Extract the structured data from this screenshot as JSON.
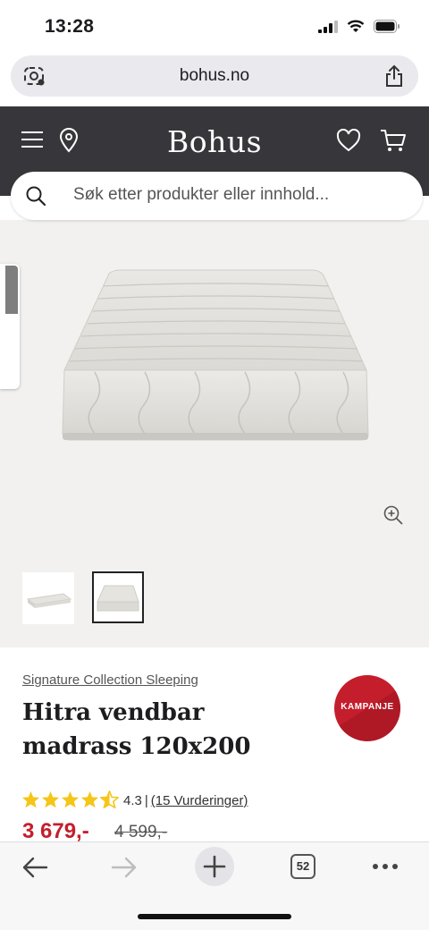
{
  "status_bar": {
    "time": "13:28"
  },
  "browser": {
    "url": "bohus.no",
    "tab_count": "52"
  },
  "header": {
    "brand": "Bohus"
  },
  "search": {
    "placeholder": "Søk etter produkter eller innhold..."
  },
  "product": {
    "brand_line": "Signature Collection Sleeping",
    "title": "Hitra vendbar madrass 120x200",
    "badge": "KAMPANJE",
    "rating_value": "4.3",
    "rating_separator": "|",
    "reviews": "(15 Vurderinger)",
    "rating_stars": 4.3,
    "price": "3 679,-",
    "old_price": "4 599,-"
  },
  "gallery": {
    "thumbnail_count": 2,
    "selected_thumbnail": 2
  },
  "icons": {
    "menu": "hamburger-icon",
    "location": "map-pin-icon",
    "wishlist": "heart-icon",
    "cart": "cart-icon",
    "search": "search-icon",
    "zoom": "zoom-in-icon",
    "back": "arrow-left-icon",
    "forward": "arrow-right-icon",
    "new_tab": "plus-icon",
    "tabs": "tabs-icon",
    "more": "more-dots-icon",
    "share": "share-icon"
  },
  "colors": {
    "header_bg": "#37373b",
    "accent_red": "#c41e2c",
    "star": "#f5c518",
    "gallery_bg": "#f2f1ef"
  }
}
